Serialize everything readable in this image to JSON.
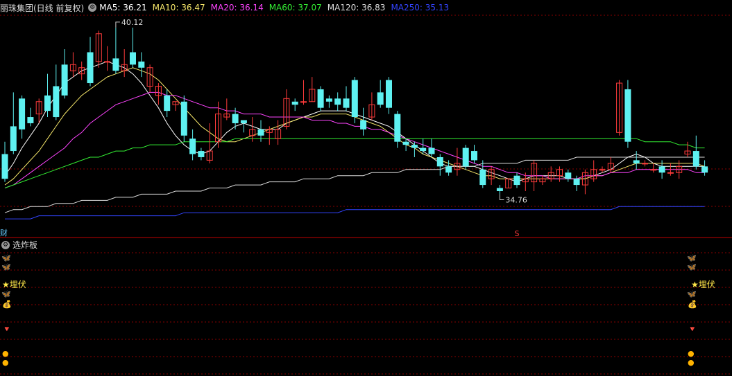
{
  "header": {
    "stock": "丽珠集团(日线 前复权)",
    "ma": [
      {
        "label": "MA5: 36.21",
        "color": "#ffffff"
      },
      {
        "label": "MA10: 36.47",
        "color": "#f5e66a"
      },
      {
        "label": "MA20: 36.14",
        "color": "#ff44ff"
      },
      {
        "label": "MA60: 37.07",
        "color": "#33ee33"
      },
      {
        "label": "MA120: 36.83",
        "color": "#dddddd"
      },
      {
        "label": "MA250: 35.13",
        "color": "#3344ff"
      }
    ]
  },
  "markers": {
    "high": "40.12",
    "low": "34.76",
    "s_label": "S",
    "fin_label": "财"
  },
  "panel": {
    "title": "选炸板",
    "maifu": "★埋伏"
  },
  "colors": {
    "up": "#ff3b3b",
    "down": "#5ef1f1",
    "grid": "#8a0000"
  },
  "chart_data": {
    "type": "candlestick",
    "ylim": [
      33.7,
      40.5
    ],
    "candles": [
      [
        36.0,
        35.2,
        36.4,
        35.1
      ],
      [
        36.9,
        36.1,
        38.0,
        36.0
      ],
      [
        37.8,
        36.8,
        37.9,
        36.5
      ],
      [
        37.2,
        37.0,
        37.5,
        36.9
      ],
      [
        37.3,
        37.7,
        37.8,
        37.0
      ],
      [
        37.9,
        37.4,
        38.6,
        37.2
      ],
      [
        38.2,
        37.2,
        38.9,
        37.1
      ],
      [
        38.9,
        37.9,
        39.4,
        37.8
      ],
      [
        38.7,
        38.9,
        39.3,
        38.5
      ],
      [
        38.6,
        38.8,
        39.0,
        38.4
      ],
      [
        39.3,
        38.3,
        39.8,
        38.2
      ],
      [
        39.0,
        39.9,
        40.0,
        38.8
      ],
      [
        39.0,
        39.0,
        39.5,
        38.7
      ],
      [
        39.1,
        38.7,
        40.1,
        38.6
      ],
      [
        38.7,
        38.9,
        39.4,
        38.5
      ],
      [
        39.3,
        38.9,
        40.1,
        38.8
      ],
      [
        39.0,
        38.8,
        39.3,
        38.5
      ],
      [
        38.2,
        38.8,
        38.9,
        38.0
      ],
      [
        37.9,
        38.2,
        38.3,
        37.6
      ],
      [
        37.9,
        37.4,
        38.1,
        37.2
      ],
      [
        37.6,
        37.7,
        37.7,
        37.4
      ],
      [
        37.7,
        36.6,
        37.9,
        36.4
      ],
      [
        36.5,
        36.0,
        36.8,
        35.8
      ],
      [
        36.1,
        35.9,
        36.2,
        35.8
      ],
      [
        35.8,
        36.1,
        37.0,
        35.7
      ],
      [
        36.4,
        37.3,
        37.7,
        36.2
      ],
      [
        37.2,
        37.3,
        37.8,
        37.1
      ],
      [
        37.3,
        37.0,
        37.5,
        36.8
      ],
      [
        37.1,
        37.0,
        37.1,
        36.7
      ],
      [
        36.6,
        36.8,
        37.2,
        36.4
      ],
      [
        36.8,
        36.6,
        37.1,
        36.4
      ],
      [
        36.7,
        36.8,
        36.9,
        36.3
      ],
      [
        36.5,
        36.8,
        37.1,
        36.3
      ],
      [
        36.9,
        37.8,
        38.1,
        36.8
      ],
      [
        37.7,
        37.6,
        37.8,
        37.4
      ],
      [
        37.7,
        37.7,
        38.4,
        37.6
      ],
      [
        37.7,
        38.1,
        38.5,
        37.7
      ],
      [
        38.1,
        37.5,
        38.2,
        37.4
      ],
      [
        37.8,
        37.7,
        37.9,
        37.5
      ],
      [
        37.8,
        37.6,
        38.0,
        37.4
      ],
      [
        37.8,
        37.5,
        38.2,
        37.4
      ],
      [
        38.4,
        37.2,
        38.5,
        37.0
      ],
      [
        37.1,
        36.8,
        37.5,
        36.6
      ],
      [
        37.2,
        37.6,
        38.0,
        37.1
      ],
      [
        38.0,
        37.6,
        38.4,
        37.5
      ],
      [
        38.4,
        37.5,
        38.5,
        37.3
      ],
      [
        37.3,
        36.4,
        37.4,
        36.2
      ],
      [
        36.4,
        36.3,
        36.5,
        36.1
      ],
      [
        36.3,
        36.2,
        36.4,
        35.9
      ],
      [
        36.2,
        36.1,
        36.5,
        36.0
      ],
      [
        36.2,
        36.0,
        36.5,
        35.9
      ],
      [
        35.9,
        35.6,
        36.0,
        35.3
      ],
      [
        35.6,
        35.4,
        35.8,
        35.3
      ],
      [
        35.5,
        35.7,
        36.2,
        35.3
      ],
      [
        36.2,
        35.6,
        36.3,
        35.5
      ],
      [
        36.1,
        35.8,
        36.3,
        35.7
      ],
      [
        35.5,
        35.0,
        35.8,
        34.9
      ],
      [
        35.2,
        35.5,
        35.6,
        35.0
      ],
      [
        34.9,
        34.8,
        35.0,
        34.7
      ],
      [
        34.9,
        35.2,
        35.2,
        34.9
      ],
      [
        35.3,
        35.0,
        35.4,
        34.9
      ],
      [
        35.1,
        35.2,
        35.4,
        34.8
      ],
      [
        35.1,
        35.7,
        35.8,
        34.8
      ],
      [
        35.1,
        35.2,
        35.3,
        35.0
      ],
      [
        35.2,
        35.4,
        35.6,
        35.1
      ],
      [
        35.3,
        35.5,
        35.6,
        35.1
      ],
      [
        35.4,
        35.2,
        35.5,
        35.1
      ],
      [
        35.2,
        35.0,
        35.3,
        34.8
      ],
      [
        35.0,
        35.4,
        35.5,
        34.7
      ],
      [
        35.2,
        35.5,
        35.8,
        35.1
      ],
      [
        35.5,
        35.5,
        35.6,
        35.4
      ],
      [
        35.5,
        35.7,
        35.9,
        35.4
      ],
      [
        36.7,
        38.3,
        38.4,
        36.6
      ],
      [
        38.1,
        36.4,
        38.4,
        36.2
      ],
      [
        35.8,
        35.7,
        36.1,
        35.5
      ],
      [
        35.7,
        35.7,
        35.8,
        35.6
      ],
      [
        35.5,
        35.5,
        35.7,
        35.4
      ],
      [
        35.6,
        35.4,
        35.8,
        35.2
      ],
      [
        35.4,
        35.4,
        35.7,
        35.3
      ],
      [
        35.4,
        35.6,
        35.8,
        35.2
      ],
      [
        36.0,
        36.1,
        36.4,
        35.9
      ],
      [
        36.1,
        35.6,
        36.6,
        35.5
      ],
      [
        35.6,
        35.4,
        35.8,
        35.3
      ]
    ],
    "ma": {
      "MA5": [
        35.3,
        35.7,
        36.2,
        36.6,
        37.0,
        37.5,
        37.9,
        38.3,
        38.5,
        38.7,
        38.8,
        38.9,
        39.0,
        38.9,
        38.8,
        38.6,
        38.3,
        37.9,
        37.5,
        37.0,
        36.6,
        36.3,
        36.1,
        36.0,
        36.1,
        36.4,
        36.7,
        36.9,
        37.0,
        36.9,
        36.8,
        36.8,
        36.8,
        37.0,
        37.1,
        37.2,
        37.3,
        37.4,
        37.4,
        37.4,
        37.4,
        37.3,
        37.2,
        37.1,
        37.0,
        36.9,
        36.7,
        36.5,
        36.3,
        36.1,
        35.9,
        35.7,
        35.6,
        35.6,
        35.6,
        35.6,
        35.5,
        35.4,
        35.3,
        35.2,
        35.1,
        35.2,
        35.3,
        35.3,
        35.3,
        35.3,
        35.2,
        35.2,
        35.2,
        35.3,
        35.4,
        35.5,
        35.7,
        35.9,
        36.0,
        35.9,
        35.7,
        35.6,
        35.6,
        35.6,
        35.6,
        35.6,
        35.6
      ],
      "MA10": [
        35.0,
        35.2,
        35.5,
        35.8,
        36.1,
        36.5,
        36.9,
        37.3,
        37.6,
        37.9,
        38.1,
        38.3,
        38.5,
        38.6,
        38.7,
        38.8,
        38.7,
        38.6,
        38.4,
        38.1,
        37.8,
        37.5,
        37.2,
        36.9,
        36.7,
        36.5,
        36.4,
        36.4,
        36.5,
        36.6,
        36.7,
        36.8,
        36.9,
        37.0,
        37.1,
        37.2,
        37.2,
        37.3,
        37.3,
        37.3,
        37.3,
        37.2,
        37.1,
        37.0,
        36.9,
        36.7,
        36.5,
        36.3,
        36.2,
        36.0,
        35.9,
        35.8,
        35.7,
        35.6,
        35.5,
        35.4,
        35.3,
        35.3,
        35.2,
        35.2,
        35.2,
        35.2,
        35.2,
        35.2,
        35.2,
        35.2,
        35.2,
        35.2,
        35.2,
        35.3,
        35.3,
        35.4,
        35.5,
        35.6,
        35.7,
        35.7,
        35.7,
        35.7,
        35.7,
        35.7,
        35.7,
        35.7,
        35.6
      ],
      "MA20": [
        34.9,
        35.0,
        35.2,
        35.4,
        35.6,
        35.8,
        36.0,
        36.2,
        36.5,
        36.7,
        37.0,
        37.2,
        37.4,
        37.6,
        37.7,
        37.8,
        37.9,
        38.0,
        38.0,
        37.9,
        37.9,
        37.8,
        37.7,
        37.6,
        37.5,
        37.5,
        37.4,
        37.4,
        37.3,
        37.3,
        37.3,
        37.2,
        37.2,
        37.2,
        37.2,
        37.2,
        37.1,
        37.1,
        37.1,
        37.0,
        37.0,
        36.9,
        36.9,
        36.8,
        36.8,
        36.7,
        36.6,
        36.5,
        36.4,
        36.3,
        36.2,
        36.1,
        36.0,
        35.9,
        35.8,
        35.7,
        35.6,
        35.6,
        35.5,
        35.4,
        35.4,
        35.3,
        35.3,
        35.3,
        35.2,
        35.2,
        35.2,
        35.2,
        35.3,
        35.3,
        35.3,
        35.4,
        35.4,
        35.4,
        35.5,
        35.5,
        35.5,
        35.5,
        35.5,
        35.5,
        35.5,
        35.4,
        35.4
      ],
      "MA60": [
        34.9,
        35.0,
        35.1,
        35.2,
        35.3,
        35.4,
        35.5,
        35.6,
        35.7,
        35.8,
        35.9,
        35.9,
        36.0,
        36.1,
        36.1,
        36.2,
        36.2,
        36.3,
        36.3,
        36.3,
        36.3,
        36.4,
        36.4,
        36.4,
        36.4,
        36.4,
        36.4,
        36.5,
        36.5,
        36.5,
        36.5,
        36.5,
        36.5,
        36.5,
        36.5,
        36.5,
        36.5,
        36.5,
        36.5,
        36.5,
        36.5,
        36.5,
        36.5,
        36.5,
        36.5,
        36.5,
        36.5,
        36.5,
        36.5,
        36.5,
        36.5,
        36.5,
        36.5,
        36.5,
        36.5,
        36.5,
        36.5,
        36.5,
        36.5,
        36.5,
        36.5,
        36.5,
        36.5,
        36.5,
        36.5,
        36.5,
        36.5,
        36.5,
        36.5,
        36.5,
        36.5,
        36.5,
        36.5,
        36.5,
        36.5,
        36.4,
        36.4,
        36.4,
        36.4,
        36.3,
        36.3,
        36.2,
        36.2
      ],
      "MA120": [
        34.1,
        34.2,
        34.2,
        34.3,
        34.3,
        34.3,
        34.4,
        34.4,
        34.4,
        34.5,
        34.5,
        34.5,
        34.5,
        34.6,
        34.6,
        34.6,
        34.7,
        34.7,
        34.7,
        34.7,
        34.8,
        34.8,
        34.8,
        34.8,
        34.9,
        34.9,
        34.9,
        35.0,
        35.0,
        35.0,
        35.0,
        35.1,
        35.1,
        35.1,
        35.1,
        35.2,
        35.2,
        35.2,
        35.2,
        35.3,
        35.3,
        35.3,
        35.3,
        35.4,
        35.4,
        35.4,
        35.4,
        35.5,
        35.5,
        35.5,
        35.5,
        35.5,
        35.6,
        35.6,
        35.6,
        35.6,
        35.7,
        35.7,
        35.7,
        35.7,
        35.7,
        35.8,
        35.8,
        35.8,
        35.8,
        35.8,
        35.8,
        35.9,
        35.9,
        35.9,
        35.9,
        35.9,
        35.9,
        35.9,
        35.9,
        35.9,
        35.9,
        35.9,
        35.9,
        35.9,
        35.9,
        35.9,
        35.9
      ],
      "MA250": [
        33.9,
        33.9,
        33.9,
        33.9,
        34.0,
        34.0,
        34.0,
        34.0,
        34.0,
        34.0,
        34.0,
        34.0,
        34.0,
        34.0,
        34.0,
        34.0,
        34.0,
        34.0,
        34.0,
        34.0,
        34.0,
        34.1,
        34.1,
        34.1,
        34.1,
        34.1,
        34.1,
        34.1,
        34.1,
        34.1,
        34.1,
        34.1,
        34.1,
        34.1,
        34.1,
        34.1,
        34.1,
        34.1,
        34.1,
        34.1,
        34.2,
        34.2,
        34.2,
        34.2,
        34.2,
        34.2,
        34.2,
        34.2,
        34.2,
        34.2,
        34.2,
        34.2,
        34.2,
        34.2,
        34.2,
        34.2,
        34.2,
        34.2,
        34.2,
        34.2,
        34.2,
        34.2,
        34.2,
        34.2,
        34.2,
        34.2,
        34.2,
        34.2,
        34.2,
        34.2,
        34.2,
        34.2,
        34.3,
        34.3,
        34.3,
        34.3,
        34.3,
        34.3,
        34.3,
        34.3,
        34.3,
        34.3,
        34.3
      ]
    }
  }
}
